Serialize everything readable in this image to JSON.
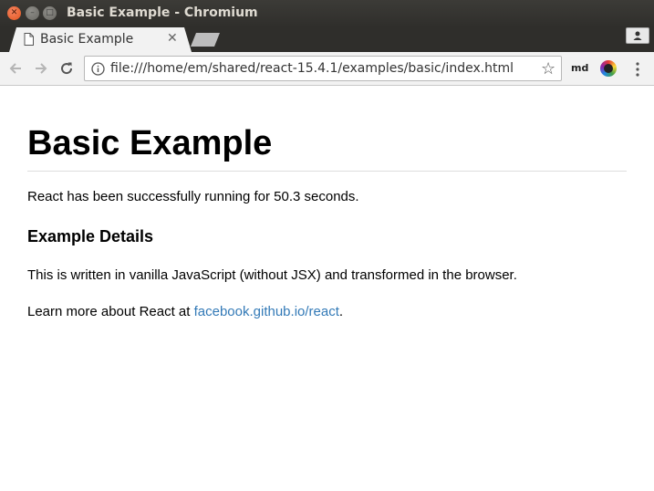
{
  "window": {
    "title": "Basic Example - Chromium"
  },
  "tabs": [
    {
      "label": "Basic Example",
      "active": true
    }
  ],
  "toolbar": {
    "url": "file:///home/em/shared/react-15.4.1/examples/basic/index.html",
    "extensions": [
      {
        "label": "md",
        "icon": "md-extension-icon"
      },
      {
        "label": "",
        "icon": "color-wheel-extension-icon"
      }
    ]
  },
  "page": {
    "heading": "Basic Example",
    "running_text": "React has been successfully running for 50.3 seconds.",
    "details_heading": "Example Details",
    "description": "This is written in vanilla JavaScript (without JSX) and transformed in the browser.",
    "learn_prefix": "Learn more about React at ",
    "learn_link": "facebook.github.io/react",
    "learn_suffix": "."
  },
  "colors": {
    "link": "#337ab7",
    "titlebar": "#3c3b37",
    "close_button": "#e2561f"
  }
}
